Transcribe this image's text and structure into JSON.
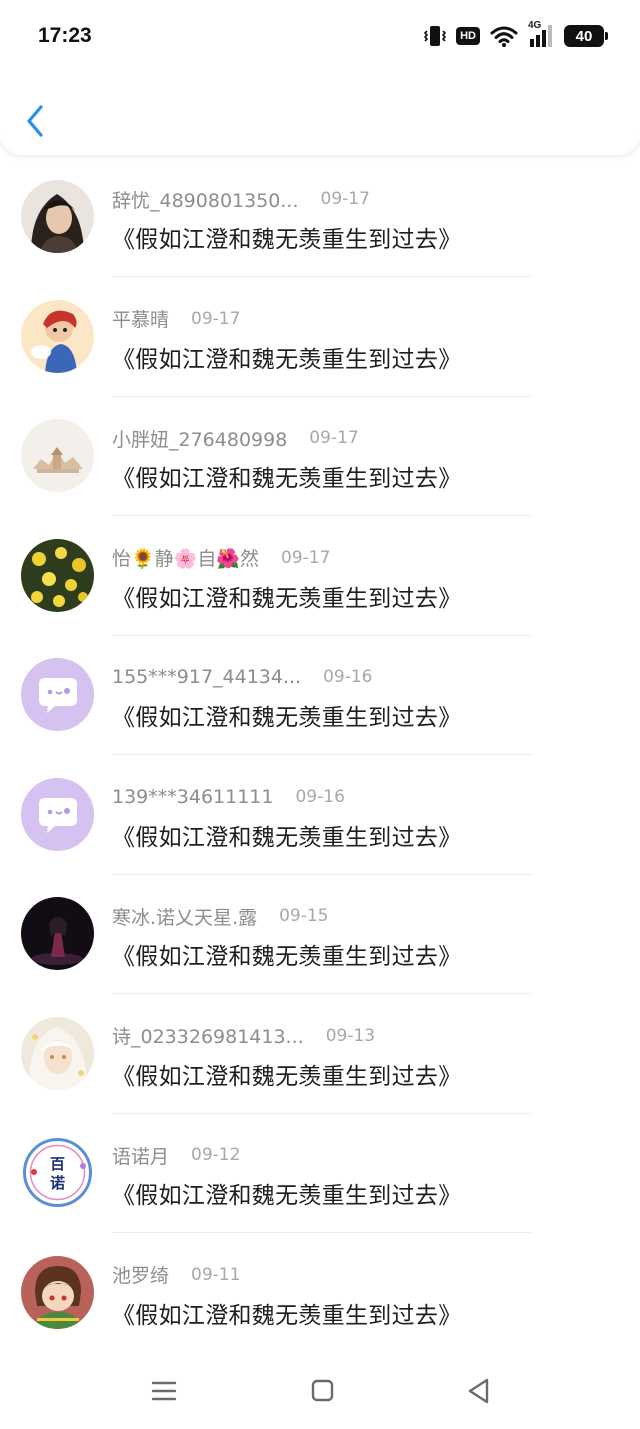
{
  "status_bar": {
    "time": "17:23",
    "hd_label": "HD",
    "network_label": "4G",
    "battery": "40"
  },
  "header": {
    "back_icon": "chevron-left-icon"
  },
  "colors": {
    "accent": "#2b8ee8",
    "username": "#8d8d8d",
    "date": "#a8a8a8",
    "message": "#1e1e1e",
    "divider": "#eeeeee"
  },
  "messages": [
    {
      "username": "辞忧_4890801350...",
      "date": "09-17",
      "text": "《假如江澄和魏无羡重生到过去》",
      "avatar": "anime-girl-dark-hair"
    },
    {
      "username": "平慕晴",
      "date": "09-17",
      "text": "《假如江澄和魏无羡重生到过去》",
      "avatar": "cartoon-boy-red-hair"
    },
    {
      "username": "小胖妞_276480998",
      "date": "09-17",
      "text": "《假如江澄和魏无羡重生到过去》",
      "avatar": "pagoda-sketch"
    },
    {
      "username": "怡🌻静🌸自🌺然",
      "date": "09-17",
      "text": "《假如江澄和魏无羡重生到过去》",
      "avatar": "yellow-flowers"
    },
    {
      "username": "155***917_44134...",
      "date": "09-16",
      "text": "《假如江澄和魏无羡重生到过去》",
      "avatar": "default-chat-bubble"
    },
    {
      "username": "139***34611111",
      "date": "09-16",
      "text": "《假如江澄和魏无羡重生到过去》",
      "avatar": "default-chat-bubble"
    },
    {
      "username": "寒冰.诺乂天星.露",
      "date": "09-15",
      "text": "《假如江澄和魏无羡重生到过去》",
      "avatar": "dark-stage-figure"
    },
    {
      "username": "诗_023326981413...",
      "date": "09-13",
      "text": "《假如江澄和魏无羡重生到过去》",
      "avatar": "white-hair-anime"
    },
    {
      "username": "语诺月",
      "date": "09-12",
      "text": "《假如江澄和魏无羡重生到过去》",
      "avatar": "baino-logo-seal",
      "avatar_text": "百诺"
    },
    {
      "username": "池罗绮",
      "date": "09-11",
      "text": "《假如江澄和魏无羡重生到过去》",
      "avatar": "pixel-style-child"
    }
  ],
  "navigation": {
    "menu_icon": "menu-lines-icon",
    "home_icon": "home-square-icon",
    "back_icon": "back-triangle-icon"
  }
}
